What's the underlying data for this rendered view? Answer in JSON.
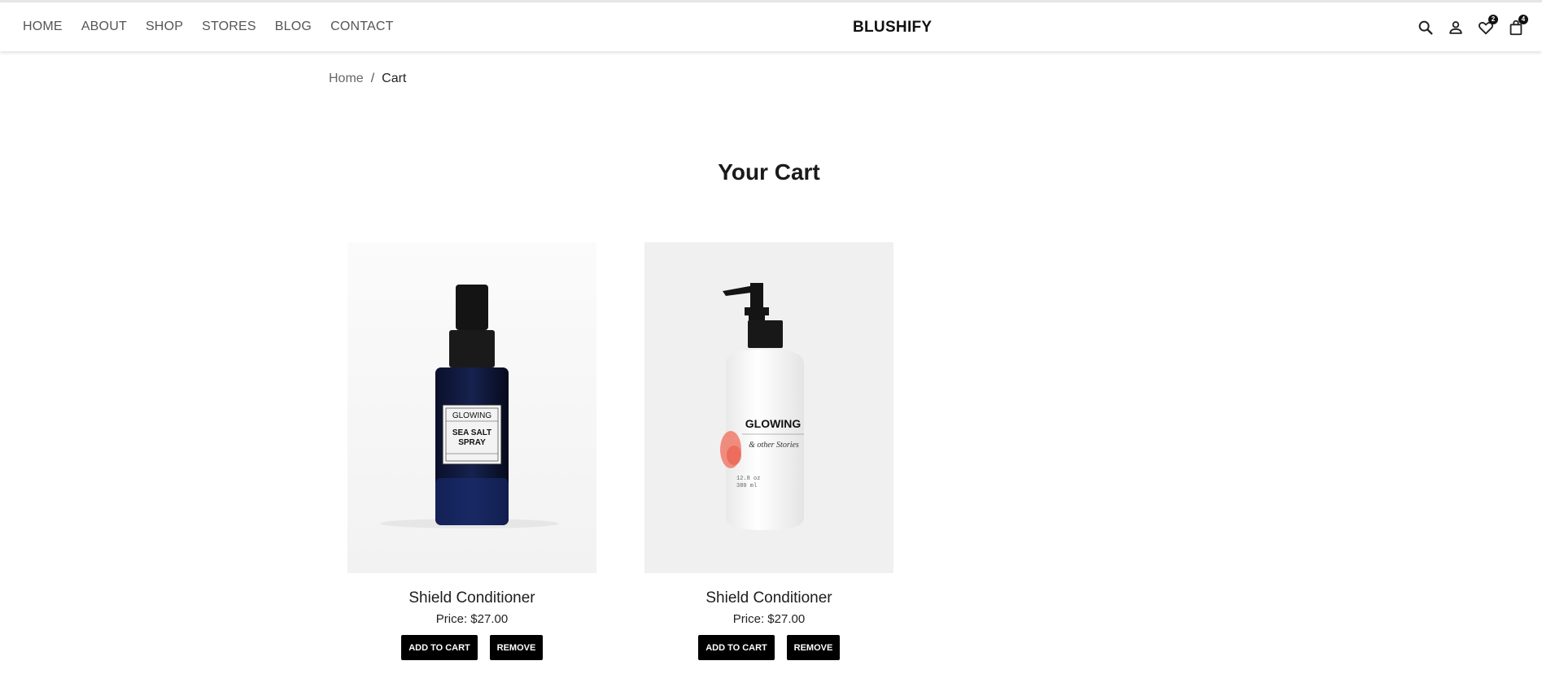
{
  "nav": {
    "items": [
      {
        "label": "HOME"
      },
      {
        "label": "ABOUT"
      },
      {
        "label": "SHOP"
      },
      {
        "label": "STORES"
      },
      {
        "label": "BLOG"
      },
      {
        "label": "CONTACT"
      }
    ]
  },
  "brand": {
    "name": "BLUSHIFY"
  },
  "header_icons": {
    "search": "search-icon",
    "account": "user-icon",
    "wishlist": {
      "icon": "heart-icon",
      "count": "2"
    },
    "cart": {
      "icon": "bag-icon",
      "count": "4"
    }
  },
  "breadcrumb": {
    "home": "Home",
    "separator": "/",
    "current": "Cart"
  },
  "page": {
    "title": "Your Cart"
  },
  "cart": {
    "items": [
      {
        "name": "Shield Conditioner",
        "price": "Price: $27.00",
        "add_label": "ADD TO CART",
        "remove_label": "REMOVE",
        "label_brand": "GLOWING",
        "label_product": "SEA SALT SPRAY"
      },
      {
        "name": "Shield Conditioner",
        "price": "Price: $27.00",
        "add_label": "ADD TO CART",
        "remove_label": "REMOVE",
        "label_brand": "GLOWING",
        "label_product": "& other Stories"
      }
    ]
  },
  "colors": {
    "accent": "#000000",
    "nav_text": "#555555",
    "background": "#ffffff"
  }
}
